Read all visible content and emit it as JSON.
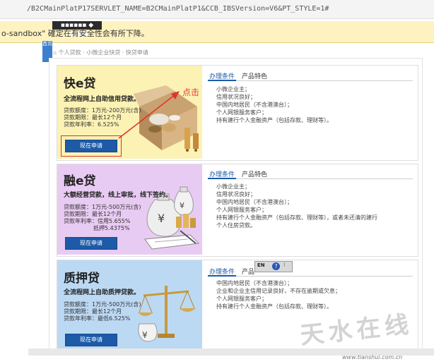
{
  "browser": {
    "url": "/B2CMainPlatP17SERVLET_NAME=B2CMainPlatP1&CCB_IBSVersion=V6&PT_STYLE=1#"
  },
  "warning_bar": {
    "text": "o-sandbox\" 確定在有安全性会有所下降。",
    "tab_dots": "▪▪▪▪▪▪ ◆ ▪▪▪▪▪"
  },
  "sidebar": {
    "tab_label": "首页"
  },
  "breadcrumb": {
    "text": "个人贷款 · 小微企业快贷 · 快贷申请"
  },
  "annotation": {
    "click_label": "点击"
  },
  "products": [
    {
      "title": "快e贷",
      "subtitle": "全流程网上自助信用贷款。",
      "lines": [
        "贷款额度：1万元-200万元(含)",
        "贷款期限：最长12个月",
        "贷款年利率：6.525%"
      ],
      "apply_label": "现在申请",
      "tab_active": "办理条件",
      "tab_other": "产品特色",
      "conditions": [
        "小微企业主；",
        "信用状况良好；",
        "中国内地居民（不含港澳台）；",
        "个人网银服务客户；",
        "持有建行个人金融资产（包括存款、理财等）。"
      ],
      "banner_color": "#fbf2b4"
    },
    {
      "title": "融e贷",
      "subtitle": "大额经营贷款，线上审批，线下签约。",
      "lines": [
        "贷款额度：1万元-500万元(含)",
        "贷款期限：最长12个月",
        "贷款年利率：信用5.655%",
        "抵押5.4375%"
      ],
      "apply_label": "现在申请",
      "tab_active": "办理条件",
      "tab_other": "产品特色",
      "conditions": [
        "小微企业主；",
        "信用状况良好；",
        "中国内地居民（不含港澳台）；",
        "个人网银服务客户；",
        "持有建行个人金融资产（包括存款、理财等），或者未还清的建行",
        "个人住房贷款。"
      ],
      "banner_color": "#e8cbf2"
    },
    {
      "title": "质押贷",
      "subtitle": "全流程网上自助质押贷款。",
      "lines": [
        "贷款额度：1万元-500万元(含)",
        "贷款期限：最长12个月",
        "贷款年利率：最低6.525%"
      ],
      "apply_label": "现在申请",
      "tab_active": "办理条件",
      "tab_other": "产品",
      "conditions": [
        "中国内地居民（不含港澳台）；",
        "企业和企业主信用记录良好，不存在逾期或欠息；",
        "个人网银服务客户；",
        "持有建行个人金融资产（包括存款、理财等）。"
      ],
      "banner_color": "#bcd9f4"
    }
  ],
  "float_toolbar": {
    "label": "EN"
  },
  "watermark": {
    "text": "天水在线",
    "url": "www.tianshui.com.cn"
  }
}
